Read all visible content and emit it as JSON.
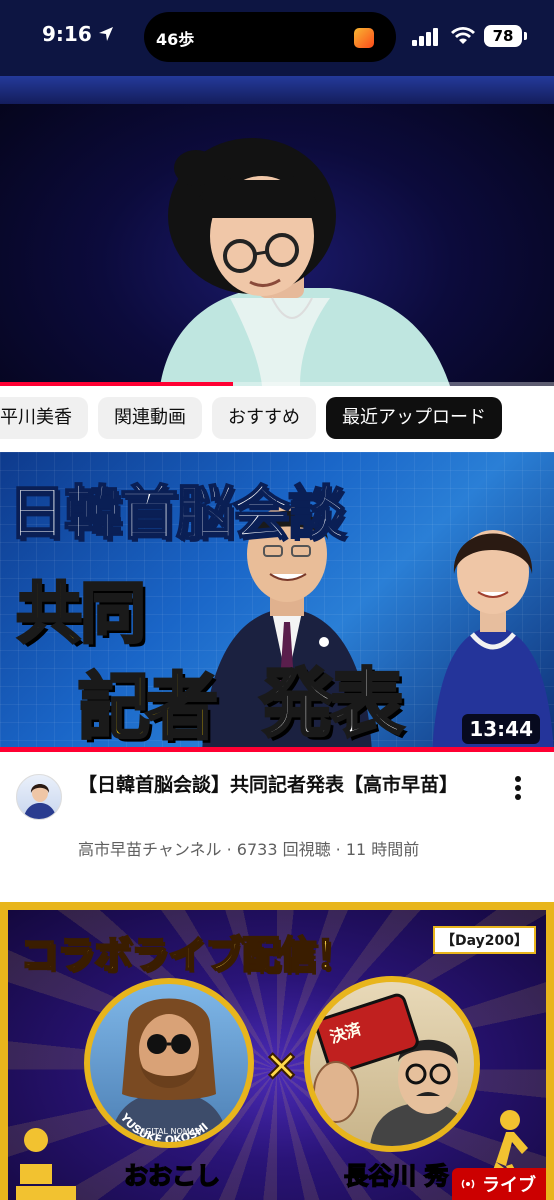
{
  "status_bar": {
    "time": "9:16",
    "steps": "46歩",
    "battery": "78"
  },
  "player": {
    "progress": 0.42
  },
  "chips": [
    {
      "label": "平川美香",
      "active": false
    },
    {
      "label": "関連動画",
      "active": false
    },
    {
      "label": "おすすめ",
      "active": false
    },
    {
      "label": "最近アップロード",
      "active": true
    }
  ],
  "video1": {
    "thumb_title_line1": "日韓首脳会談",
    "thumb_title_line2": "共同",
    "thumb_title_line3a": "記者",
    "thumb_title_line3b": "発表",
    "duration": "13:44",
    "title": "【日韓首脳会談】共同記者発表【高市早苗】",
    "subtitle": "高市早苗チャンネル · 6733 回視聴 · 11 時間前"
  },
  "video2": {
    "thumb_title": "コラボライブ配信！",
    "day_badge": "【Day200】",
    "times": "×",
    "name_left": "おおこし",
    "name_right": "長谷川 秀",
    "circle_text": "YUSUKE OKOSHI",
    "circle_sub": "DIGITAL NOMAD",
    "live_label": "ライブ"
  },
  "colors": {
    "accent_red": "#ff0033",
    "chip_bg": "#f0f0f0",
    "chip_active": "#0f0f0f"
  }
}
